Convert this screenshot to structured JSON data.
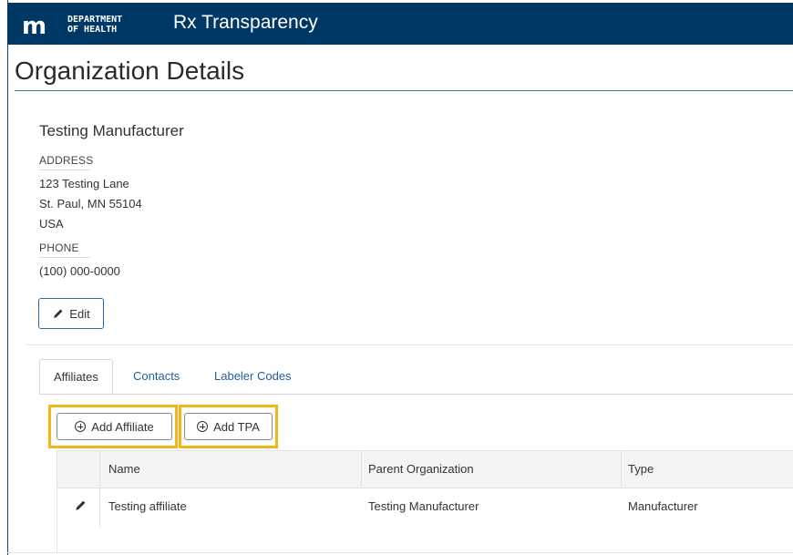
{
  "header": {
    "logo_mark": "m",
    "logo_line1": "DEPARTMENT",
    "logo_line2": "OF HEALTH",
    "app_title": "Rx Transparency"
  },
  "page": {
    "title": "Organization Details"
  },
  "organization": {
    "name": "Testing Manufacturer",
    "address_label": "ADDRESS",
    "address_line1": "123 Testing Lane",
    "address_line2": "St. Paul, MN 55104",
    "address_line3": "USA",
    "phone_label": "PHONE",
    "phone": "(100) 000-0000",
    "edit_label": "Edit"
  },
  "tabs": [
    {
      "label": "Affiliates",
      "active": true
    },
    {
      "label": "Contacts",
      "active": false
    },
    {
      "label": "Labeler Codes",
      "active": false
    }
  ],
  "actions": {
    "add_affiliate": "Add Affiliate",
    "add_tpa": "Add TPA"
  },
  "table": {
    "columns": [
      "Name",
      "Parent Organization",
      "Type"
    ],
    "rows": [
      {
        "name": "Testing affiliate",
        "parent": "Testing Manufacturer",
        "type": "Manufacturer"
      }
    ]
  },
  "colors": {
    "header_bg": "#003865",
    "highlight": "#f2b61a",
    "link": "#1f5e9c"
  }
}
